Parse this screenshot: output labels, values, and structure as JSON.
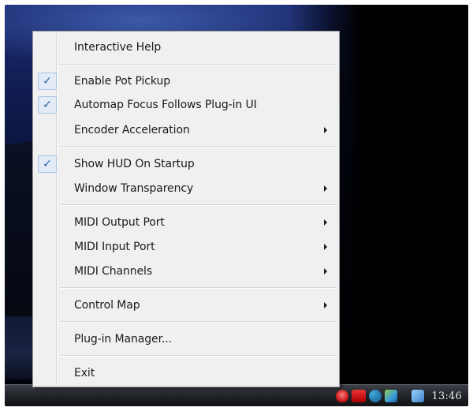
{
  "menu": {
    "items": [
      {
        "label": "Interactive Help",
        "checked": false,
        "submenu": false
      },
      {
        "label": "Enable Pot Pickup",
        "checked": true,
        "submenu": false
      },
      {
        "label": "Automap Focus Follows Plug-in UI",
        "checked": true,
        "submenu": false
      },
      {
        "label": "Encoder Acceleration",
        "checked": false,
        "submenu": true
      },
      {
        "label": "Show HUD On Startup",
        "checked": true,
        "submenu": false
      },
      {
        "label": "Window Transparency",
        "checked": false,
        "submenu": true
      },
      {
        "label": "MIDI Output Port",
        "checked": false,
        "submenu": true
      },
      {
        "label": "MIDI Input Port",
        "checked": false,
        "submenu": true
      },
      {
        "label": "MIDI Channels",
        "checked": false,
        "submenu": true
      },
      {
        "label": "Control Map",
        "checked": false,
        "submenu": true
      },
      {
        "label": "Plug-in Manager...",
        "checked": false,
        "submenu": false
      },
      {
        "label": "Exit",
        "checked": false,
        "submenu": false
      }
    ],
    "check_glyph": "✓"
  },
  "taskbar": {
    "tray_icons": [
      "antivirus-shield-icon",
      "alert-icon",
      "network-icon",
      "display-icon",
      "speaker-icon"
    ],
    "clock": "13:46"
  },
  "colors": {
    "menu_bg": "#f0f0f0",
    "check_accent": "#2d5fa8",
    "taskbar": "#23262b"
  }
}
